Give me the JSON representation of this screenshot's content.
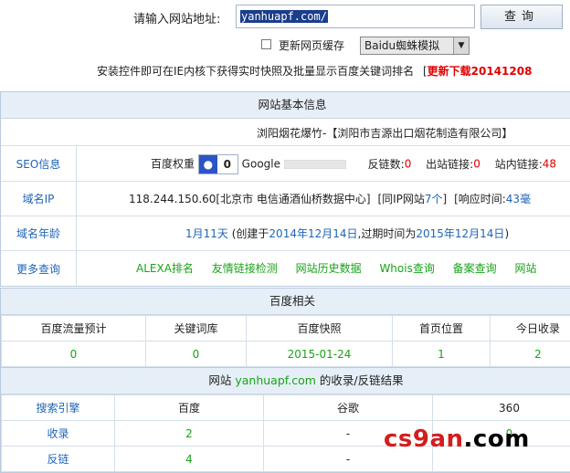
{
  "search": {
    "label": "请输入网站地址:",
    "value": "yanhuapf.com/",
    "button": "查询",
    "refresh_label": "更新网页缓存",
    "refresh_checked": false,
    "engine_select": "Baidu蜘蛛模拟",
    "notice_text": "安装控件即可在IE内核下获得实时快照及批量显示百度关键词排名",
    "notice_link": "更新下载20141208",
    "notice_bracket": "["
  },
  "basic": {
    "title": "网站基本信息",
    "site_name": "浏阳烟花爆竹-【浏阳市吉源出口烟花制造有限公司】",
    "seo": {
      "label": "SEO信息",
      "baidu_weight_label": "百度权重",
      "baidu_weight": "0",
      "google_label": "Google",
      "backlinks_label": "反链数:",
      "backlinks": "0",
      "outlinks_label": "出站链接:",
      "outlinks": "0",
      "inlinks_label": "站内链接:",
      "inlinks": "48"
    },
    "ip": {
      "label": "域名IP",
      "text": "118.244.150.60[北京市 电信通酒仙桥数据中心]",
      "same_ip_prefix": "[同IP网站",
      "same_ip_count": "7个",
      "same_ip_suffix": "]",
      "resp_label": "[响应时间:",
      "resp_value": "43毫"
    },
    "age": {
      "label": "域名年龄",
      "age": "1月11天",
      "created_prefix": "(创建于",
      "created": "2014年12月14日",
      "expire_prefix": ",过期时间为",
      "expire": "2015年12月14日",
      "suffix": ")"
    },
    "more": {
      "label": "更多查询",
      "links": [
        "ALEXA排名",
        "友情链接检测",
        "网站历史数据",
        "Whois查询",
        "备案查询",
        "网站"
      ]
    }
  },
  "baidu": {
    "title": "百度相关",
    "headers": [
      "百度流量预计",
      "关键词库",
      "百度快照",
      "首页位置",
      "今日收录"
    ],
    "values": [
      "0",
      "0",
      "2015-01-24",
      "1",
      "2"
    ]
  },
  "index": {
    "title_prefix": "网站",
    "site": "yanhuapf.com",
    "title_suffix": "的收录/反链结果",
    "headers": [
      "搜索引擎",
      "百度",
      "谷歌",
      "360"
    ],
    "rows": [
      {
        "label": "收录",
        "baidu": "2",
        "google": "-",
        "s360": "0"
      },
      {
        "label": "反链",
        "baidu": "4",
        "google": "-",
        "s360": ""
      }
    ]
  },
  "watermark": {
    "left": "cs9an",
    "right": ".com"
  }
}
